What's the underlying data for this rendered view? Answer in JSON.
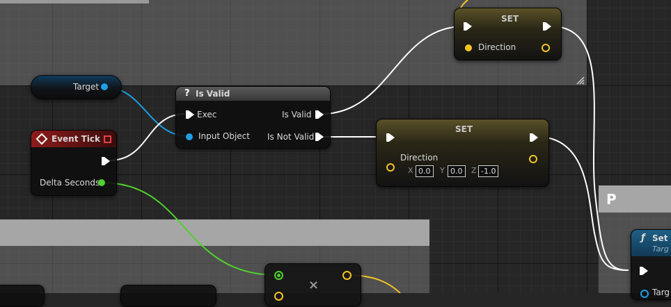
{
  "nodes": {
    "target": {
      "label": "Target"
    },
    "event_tick": {
      "title": "Event Tick",
      "delta_label": "Delta Seconds"
    },
    "is_valid": {
      "title": "Is Valid",
      "exec_label": "Exec",
      "input_label": "Input Object",
      "valid_label": "Is Valid",
      "not_valid_label": "Is Not Valid"
    },
    "set_top": {
      "title": "SET",
      "var_label": "Direction"
    },
    "set_mid": {
      "title": "SET",
      "var_label": "Direction",
      "axes": [
        "X",
        "Y",
        "Z"
      ],
      "values": [
        "0.0",
        "0.0",
        "-1.0"
      ]
    },
    "multiply": {
      "symbol": "×"
    },
    "panel": {
      "letter": "P"
    },
    "set_actor": {
      "title": "Set A",
      "subtitle": "Targ",
      "pin_label": "Targ"
    }
  },
  "colors": {
    "exec": "#ffffff",
    "object": "#1e9fe6",
    "float": "#4fd22f",
    "vector": "#f5c524",
    "event_header": "#8e1b1b",
    "set_header": "#6f6326"
  },
  "icons": {
    "is_valid": "question-icon",
    "event_tick": "event-diamond-icon",
    "multiply": "multiply-icon",
    "function": "function-icon"
  }
}
